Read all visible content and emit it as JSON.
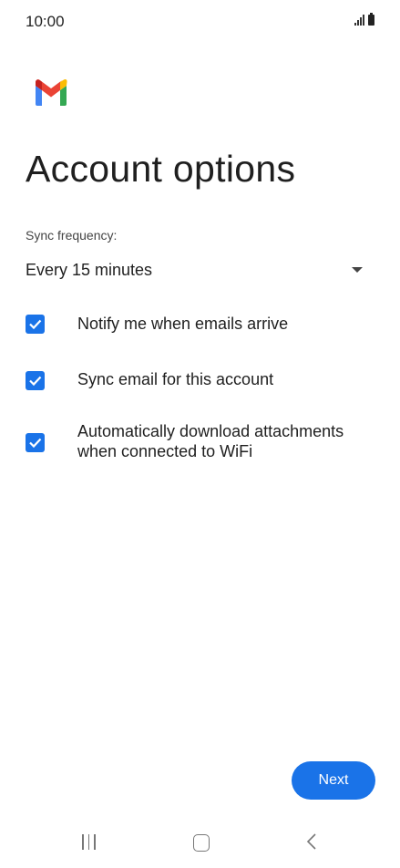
{
  "status_bar": {
    "time": "10:00"
  },
  "app": {
    "logo_icon": "gmail-logo-icon",
    "colors": {
      "accent": "#1a73e8",
      "gmail_red": "#ea4335",
      "gmail_blue": "#4285f4",
      "gmail_green": "#34a853",
      "gmail_yellow": "#fbbc04"
    }
  },
  "page": {
    "title": "Account options"
  },
  "sync": {
    "label": "Sync frequency:",
    "selected": "Every 15 minutes"
  },
  "options": [
    {
      "label": "Notify me when emails arrive",
      "checked": true
    },
    {
      "label": "Sync email for this account",
      "checked": true
    },
    {
      "label": "Automatically download attachments when connected to WiFi",
      "checked": true
    }
  ],
  "actions": {
    "next_label": "Next"
  },
  "nav_bar": {
    "icons": [
      "recent-apps-icon",
      "home-icon",
      "back-icon"
    ]
  }
}
